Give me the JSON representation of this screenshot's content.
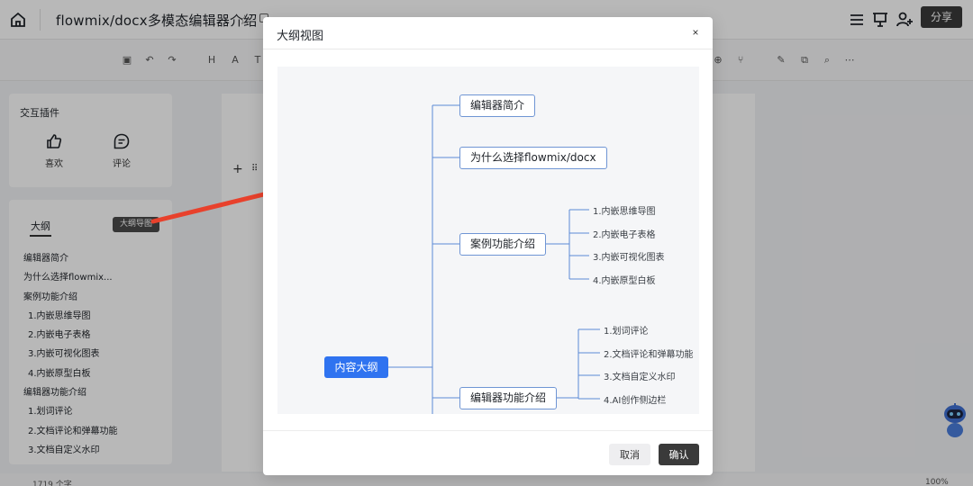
{
  "app": {
    "doc_title": "flowmix/docx多模态编辑器介绍",
    "share_label": "分享"
  },
  "left_panel": {
    "plugins_title": "交互插件",
    "plugins": [
      {
        "label": "喜欢",
        "icon": "thumbs-up-icon"
      },
      {
        "label": "评论",
        "icon": "comment-icon"
      }
    ],
    "outline_tab": "大纲",
    "mindmap_tooltip": "大纲导图",
    "outline_items": [
      {
        "text": "编辑器简介",
        "level": 1
      },
      {
        "text": "为什么选择flowmix...",
        "level": 1
      },
      {
        "text": "案例功能介绍",
        "level": 1
      },
      {
        "text": "1.内嵌思维导图",
        "level": 2
      },
      {
        "text": "2.内嵌电子表格",
        "level": 2
      },
      {
        "text": "3.内嵌可视化图表",
        "level": 2
      },
      {
        "text": "4.内嵌原型白板",
        "level": 2
      },
      {
        "text": "编辑器功能介绍",
        "level": 1
      },
      {
        "text": "1.划词评论",
        "level": 2
      },
      {
        "text": "2.文档评论和弹幕功能",
        "level": 2
      },
      {
        "text": "3.文档自定义水印",
        "level": 2
      }
    ]
  },
  "statusbar": {
    "word_count": "1719 个字",
    "zoom": "100%"
  },
  "modal": {
    "title": "大纲视图",
    "close_label": "×",
    "cancel_label": "取消",
    "confirm_label": "确认"
  },
  "mindmap": {
    "root": "内容大纲",
    "branches": [
      {
        "label": "编辑器简介",
        "children": []
      },
      {
        "label": "为什么选择flowmix/docx",
        "children": []
      },
      {
        "label": "案例功能介绍",
        "children": [
          "1.内嵌思维导图",
          "2.内嵌电子表格",
          "3.内嵌可视化图表",
          "4.内嵌原型白板"
        ]
      },
      {
        "label": "编辑器功能介绍",
        "children": [
          "1.划词评论",
          "2.文档评论和弹幕功能",
          "3.文档自定义水印",
          "4.AI创作侧边栏"
        ]
      }
    ]
  },
  "colors": {
    "root_fill": "#2f73f0",
    "node_border": "#6f95d4",
    "arrow": "#e8412c"
  }
}
